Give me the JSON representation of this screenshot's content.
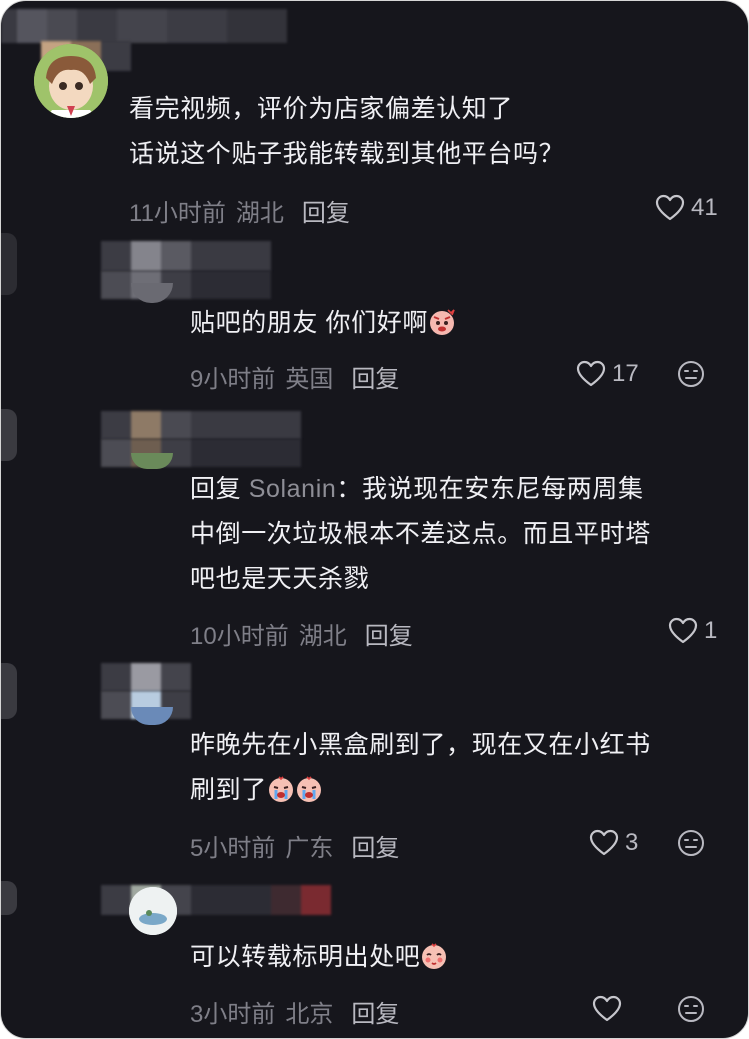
{
  "colors": {
    "background": "#16161c",
    "text": "#f0f0f4",
    "meta": "#7f7f88",
    "reply": "#b9b9c1"
  },
  "comments": [
    {
      "lines": [
        "看完视频，评价为店家偏差认知了",
        "话说这个贴子我能转载到其他平台吗？"
      ],
      "time": "11小时前",
      "location": "湖北",
      "reply_label": "回复",
      "likes": "41",
      "has_dislike": false
    },
    {
      "lines": [
        "贴吧的朋友 你们好啊"
      ],
      "emoji": "angry-face-emoji",
      "time": "9小时前",
      "location": "英国",
      "reply_label": "回复",
      "likes": "17",
      "has_dislike": true
    },
    {
      "reply_prefix": "回复",
      "mention": "Solanin",
      "lines": [
        "：我说现在安东尼每两周集",
        "中倒一次垃圾根本不差这点。而且平时塔",
        "吧也是天天杀戮"
      ],
      "time": "10小时前",
      "location": "湖北",
      "reply_label": "回复",
      "likes": "1",
      "has_dislike": false
    },
    {
      "lines": [
        "昨晚先在小黑盒刷到了，现在又在小红书",
        "刷到了"
      ],
      "emoji": "crying-face-emoji",
      "time": "5小时前",
      "location": "广东",
      "reply_label": "回复",
      "likes": "3",
      "has_dislike": true
    },
    {
      "lines": [
        "可以转载标明出处吧"
      ],
      "emoji": "shy-face-emoji",
      "time": "3小时前",
      "location": "北京",
      "reply_label": "回复",
      "likes": "",
      "has_dislike": true
    }
  ]
}
